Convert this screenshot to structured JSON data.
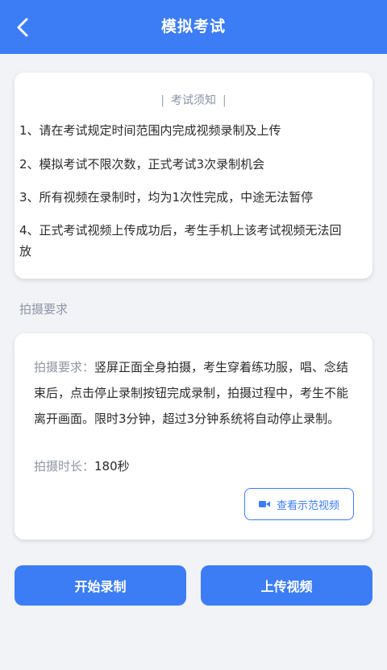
{
  "header": {
    "title": "模拟考试"
  },
  "notice": {
    "heading": "考试须知",
    "items": [
      "1、请在考试规定时间范围内完成视频录制及上传",
      "2、模拟考试不限次数，正式考试3次录制机会",
      "3、所有视频在录制时，均为1次性完成，中途无法暂停",
      "4、正式考试视频上传成功后，考生手机上该考试视频无法回放"
    ]
  },
  "section": {
    "label": "拍摄要求"
  },
  "requirements": {
    "label": "拍摄要求：",
    "text": "竖屏正面全身拍摄，考生穿着练功服，唱、念结束后，点击停止录制按钮完成录制，拍摄过程中，考生不能离开画面。限时3分钟，超过3分钟系统将自动停止录制。",
    "duration_label": "拍摄时长：",
    "duration_value": "180秒",
    "demo_button": "查看示范视频",
    "demo_icon": "video-camera-icon"
  },
  "actions": {
    "record": "开始录制",
    "upload": "上传视频"
  },
  "colors": {
    "primary": "#3c7df6",
    "background": "#f1f3f7",
    "muted": "#8f96a3"
  }
}
